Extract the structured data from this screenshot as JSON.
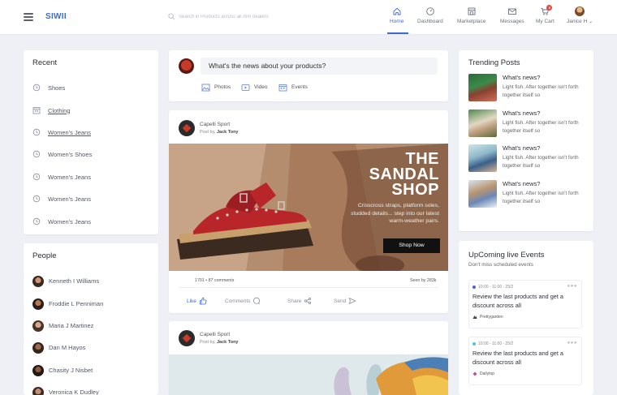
{
  "header": {
    "brand": "SIWII",
    "search_placeholder": "Search in Products across all Alm dealers",
    "nav": [
      {
        "label": "Home",
        "icon": "home-icon",
        "active": true
      },
      {
        "label": "Dashboard",
        "icon": "dashboard-icon"
      },
      {
        "label": "Marketplace",
        "icon": "marketplace-icon"
      },
      {
        "label": "Messages",
        "icon": "mail-icon"
      },
      {
        "label": "My Cart",
        "icon": "cart-icon",
        "badge": "8"
      },
      {
        "label": "Janice H",
        "icon": "avatar"
      }
    ],
    "accent_color": "#3b6bd6"
  },
  "recent": {
    "title": "Recent",
    "items": [
      "Shoes",
      "Clothing",
      "Women's Jeans",
      "Women's Shoes",
      "Women's Jeans",
      "Women's Jeans",
      "Women's Jeans"
    ]
  },
  "people": {
    "title": "People",
    "items": [
      "Kenneth I Williams",
      "Froddie L Penniman",
      "Maria J Martinez",
      "Dan M Hayos",
      "Chasity J Nisbet",
      "Veronica K Dudley"
    ]
  },
  "composer": {
    "prompt": "What's the news about your products?",
    "actions": [
      "Photos",
      "Video",
      "Events"
    ]
  },
  "post1": {
    "brand": "Capelli Sport",
    "by_label": "Post by,",
    "author": "Jack Tony",
    "image": {
      "headline": [
        "THE",
        "SANDAL",
        "SHOP"
      ],
      "description": "Crisscross straps, platform soles, studded details... step into our latest warm-weather pairs.",
      "cta": "Shop Now"
    },
    "stats_left": "1701 • 87 comments",
    "stats_right": "Seen by 283k",
    "reactions": [
      "Like",
      "Comments",
      "Share",
      "Send"
    ]
  },
  "post2": {
    "brand": "Capelli Sport",
    "by_label": "Post by,",
    "author": "Jack Tony"
  },
  "trending": {
    "title": "Trending Posts",
    "items": [
      {
        "title": "What's news?",
        "text": "Light fish. After together isn't forth together itself so"
      },
      {
        "title": "What's news?",
        "text": "Light fish. After together isn't forth together itself so"
      },
      {
        "title": "What's news?",
        "text": "Light fish. After together isn't forth together itself so"
      },
      {
        "title": "What's news?",
        "text": "Light fish. After together isn't forth together itself so"
      }
    ]
  },
  "events": {
    "title": "UpComing live Events",
    "subtitle": "Don't miss scheduled events",
    "items": [
      {
        "time": "10:00 - 11:00 - 25/2",
        "dot_color": "#5b57d9",
        "title": "Review the last products and get a discount across all",
        "brand": "Prettygarden"
      },
      {
        "time": "10:00 - 11:00 - 25/2",
        "dot_color": "#4ec3e0",
        "title": "Review the last products and get a discount across all",
        "brand": "Dailytop"
      }
    ]
  }
}
